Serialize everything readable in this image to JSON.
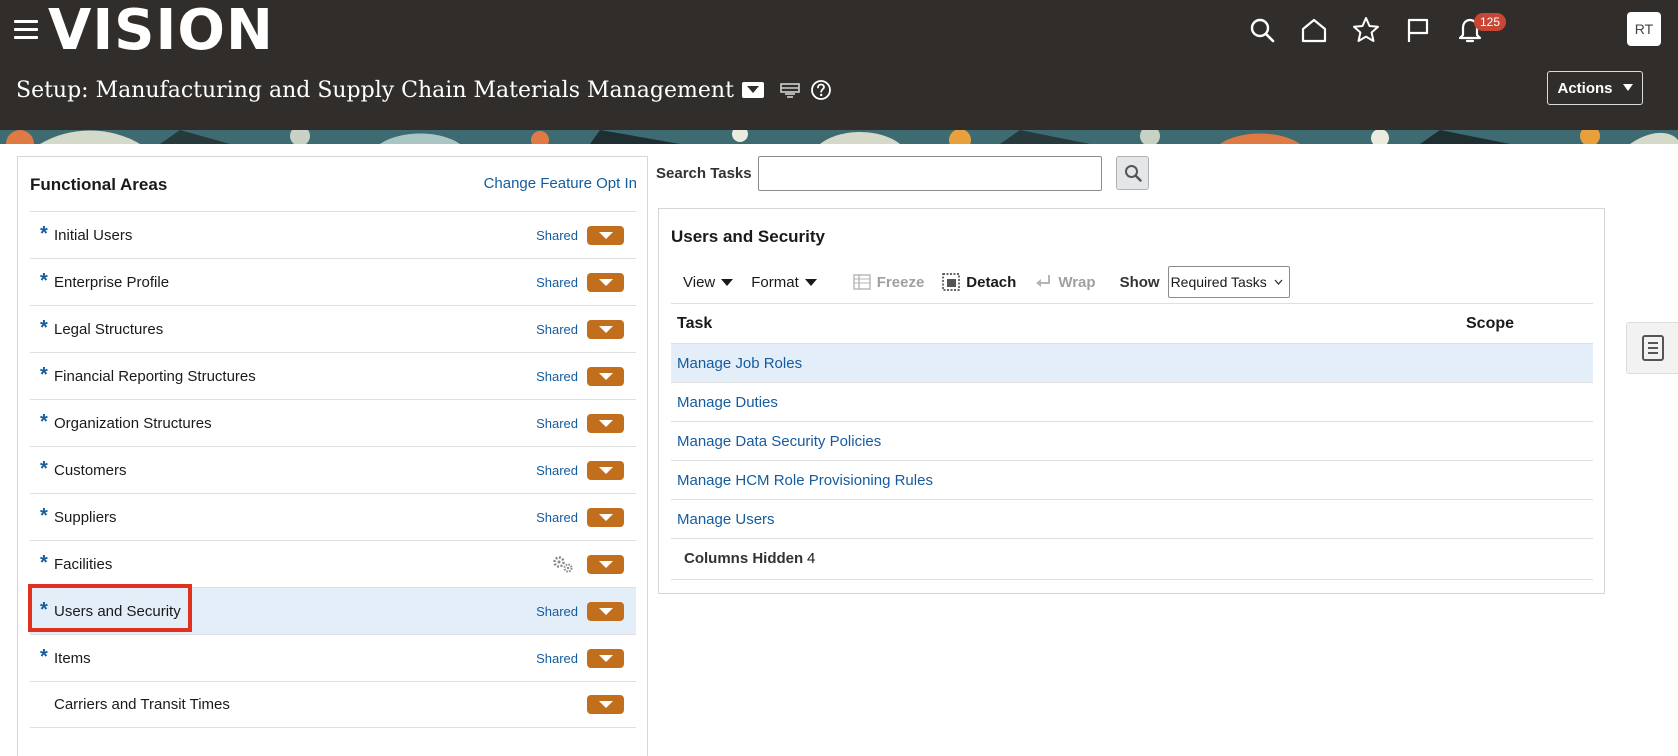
{
  "app": {
    "logo": "VISION"
  },
  "header": {
    "notification_count": "125",
    "user_initials": "RT",
    "page_title": "Setup: Manufacturing and Supply Chain Materials Management",
    "actions_label": "Actions"
  },
  "left_panel": {
    "title": "Functional Areas",
    "change_link": "Change Feature Opt In",
    "items": [
      {
        "label": "Initial Users",
        "required": "*",
        "status": "Shared"
      },
      {
        "label": "Enterprise Profile",
        "required": "*",
        "status": "Shared"
      },
      {
        "label": "Legal Structures",
        "required": "*",
        "status": "Shared"
      },
      {
        "label": "Financial Reporting Structures",
        "required": "*",
        "status": "Shared"
      },
      {
        "label": "Organization Structures",
        "required": "*",
        "status": "Shared"
      },
      {
        "label": "Customers",
        "required": "*",
        "status": "Shared"
      },
      {
        "label": "Suppliers",
        "required": "*",
        "status": "Shared"
      },
      {
        "label": "Facilities",
        "required": "*",
        "status": ""
      },
      {
        "label": "Users and Security",
        "required": "*",
        "status": "Shared",
        "selected": true
      },
      {
        "label": "Items",
        "required": "*",
        "status": "Shared"
      },
      {
        "label": "Carriers and Transit Times",
        "required": "",
        "status": ""
      }
    ]
  },
  "search": {
    "label": "Search Tasks",
    "value": ""
  },
  "right_panel": {
    "title": "Users and Security",
    "toolbar": {
      "view": "View",
      "format": "Format",
      "freeze": "Freeze",
      "detach": "Detach",
      "wrap": "Wrap",
      "show_label": "Show",
      "show_value": "Required Tasks"
    },
    "columns": {
      "task": "Task",
      "scope": "Scope"
    },
    "rows": [
      {
        "task": "Manage Job Roles",
        "selected": true
      },
      {
        "task": "Manage Duties"
      },
      {
        "task": "Manage Data Security Policies"
      },
      {
        "task": "Manage HCM Role Provisioning Rules"
      },
      {
        "task": "Manage Users"
      }
    ],
    "columns_hidden_label": "Columns Hidden",
    "columns_hidden_value": "4"
  },
  "colors": {
    "header_bg": "#312d2a",
    "link": "#145c9e",
    "dropdown_accent": "#c16f1c",
    "selection": "#e4eef9",
    "highlight_box": "#e0301e",
    "badge": "#c74634"
  },
  "icons": [
    "hamburger-icon",
    "search-icon",
    "home-icon",
    "star-icon",
    "flag-icon",
    "bell-icon",
    "help-icon",
    "table-icon",
    "gear-icon",
    "freeze-icon",
    "detach-icon",
    "wrap-icon",
    "tasks-panel-icon"
  ]
}
